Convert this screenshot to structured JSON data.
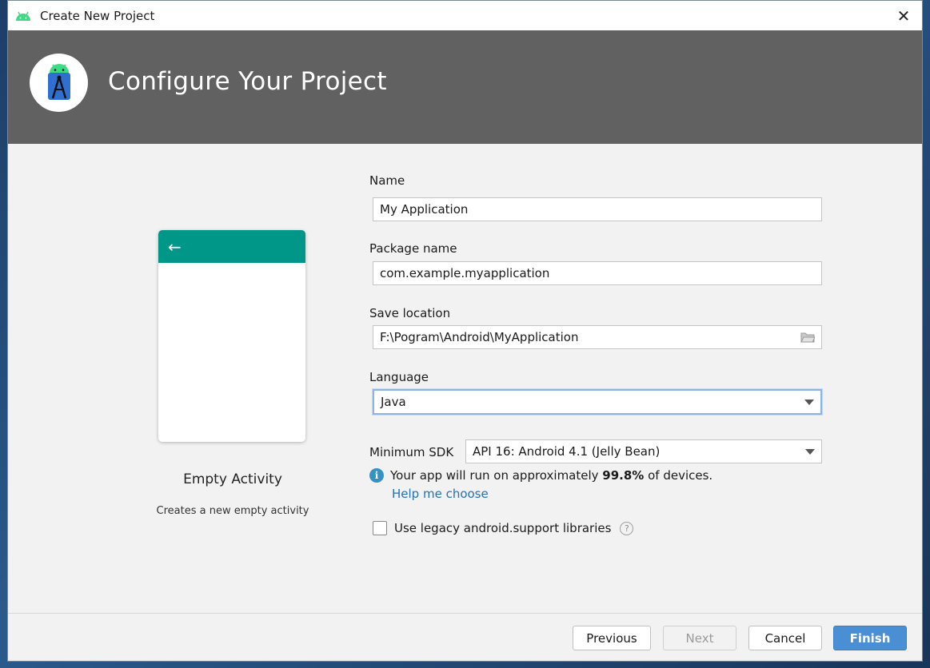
{
  "window": {
    "title": "Create New Project",
    "close_glyph": "✕"
  },
  "header": {
    "heading": "Configure Your Project"
  },
  "template": {
    "back_glyph": "←",
    "name": "Empty Activity",
    "description": "Creates a new empty activity",
    "appbar_color": "#009688"
  },
  "form": {
    "name_label": "Name",
    "name_value": "My Application",
    "package_label": "Package name",
    "package_value": "com.example.myapplication",
    "location_label": "Save location",
    "location_value": "F:\\Pogram\\Android\\MyApplication",
    "language_label": "Language",
    "language_value": "Java",
    "sdk_label": "Minimum SDK",
    "sdk_value": "API 16: Android 4.1 (Jelly Bean)",
    "info_prefix": "Your app will run on approximately ",
    "info_percent": "99.8%",
    "info_suffix": " of devices.",
    "help_link": "Help me choose",
    "legacy_label": "Use legacy android.support libraries",
    "legacy_checked": false,
    "help_glyph": "?",
    "info_glyph": "i"
  },
  "buttons": {
    "previous": "Previous",
    "next": "Next",
    "cancel": "Cancel",
    "finish": "Finish"
  },
  "icons": {
    "app": "android-icon",
    "logo": "android-studio-icon",
    "folder": "folder-icon"
  },
  "colors": {
    "header_bg": "#616161",
    "primary_button": "#4a8fd3",
    "link": "#2470b3",
    "android_green": "#3ddc84"
  }
}
